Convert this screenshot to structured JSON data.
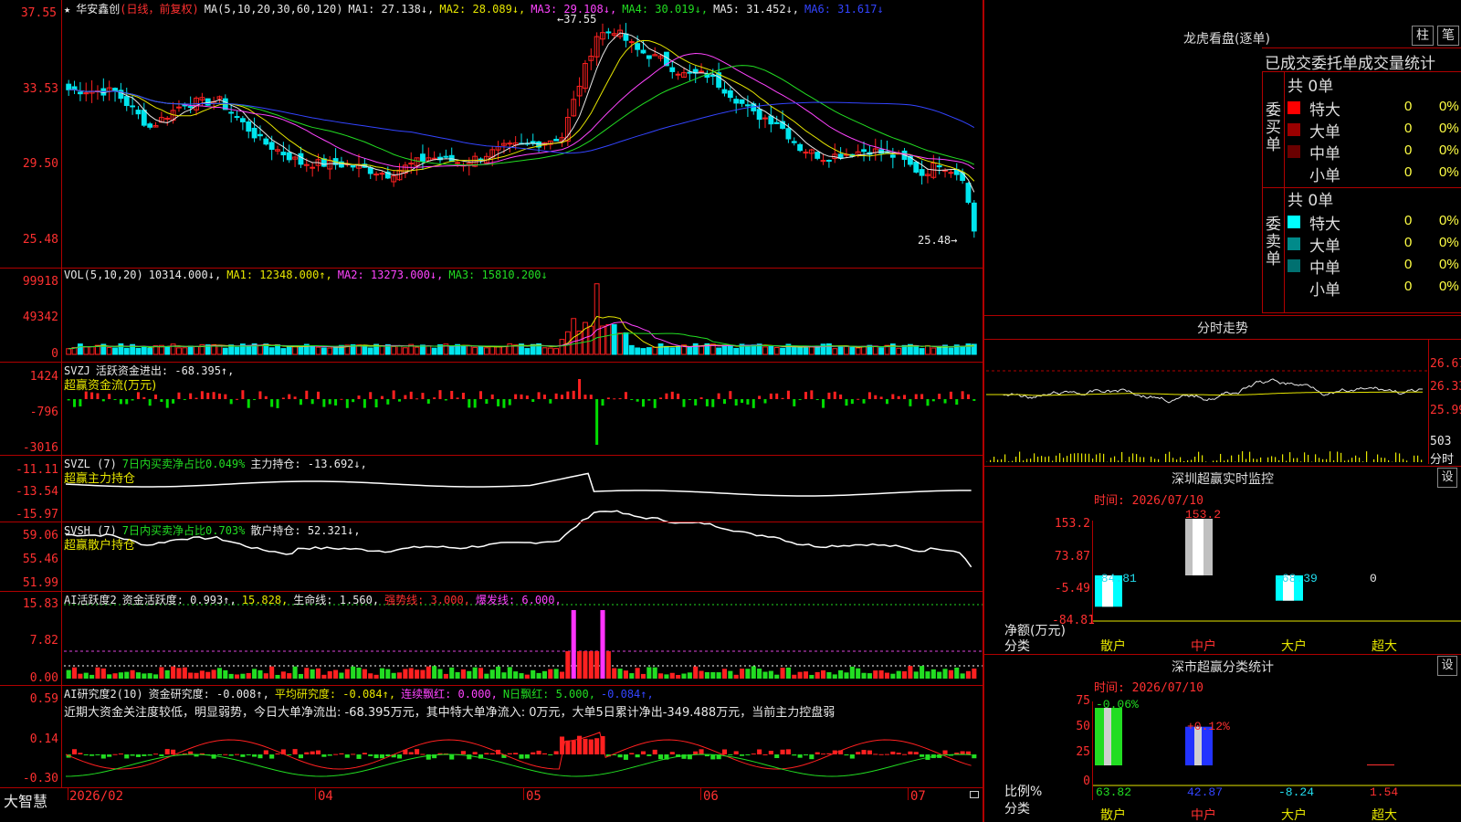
{
  "colors": {
    "up": "#ff2020",
    "down": "#00e5ee",
    "grid": "#b00000",
    "ma1": "#e8e8e8",
    "ma2": "#e6e600",
    "ma3": "#ff44ff",
    "ma4": "#22dd22",
    "ma6": "#3344ff"
  },
  "header": {
    "star": "★",
    "stock_name": "华安鑫创",
    "period": "(日线，前复权)",
    "ma_params": "MA(5,10,20,30,60,120)",
    "ma1": "MA1: 27.138↓,",
    "ma2": "MA2: 28.089↓,",
    "ma3": "MA3: 29.108↓,",
    "ma4": "MA4: 30.019↓,",
    "ma5": "MA5: 31.452↓,",
    "ma6": "MA6: 31.617↓"
  },
  "price_axis": {
    "labels": [
      "37.55",
      "33.53",
      "29.50",
      "25.48"
    ]
  },
  "price_marks": {
    "high": "37.55",
    "low": "25.48"
  },
  "vol": {
    "title": "VOL(5,10,20)",
    "value": "10314.000↓,",
    "ma1": "MA1: 12348.000↑,",
    "ma2": "MA2: 13273.000↓,",
    "ma3": "MA3: 15810.200↓",
    "axis": [
      "99918",
      "49342",
      "0"
    ]
  },
  "svzj": {
    "title": "SVZJ",
    "text": "活跃资金进出: -68.395↑,",
    "sub": "超赢资金流(万元)",
    "axis": [
      "1424",
      "-796",
      "-3016"
    ]
  },
  "svzl": {
    "title": "SVZL (7)",
    "t1": "7日内买卖净占比0.049%",
    "t2": "主力持仓: -13.692↓,",
    "sub": "超赢主力持仓",
    "axis": [
      "-11.11",
      "-13.54",
      "-15.97"
    ]
  },
  "svsh": {
    "title": "SVSH (7)",
    "t1": "7日内买卖净占比0.703%",
    "t2": "散户持仓: 52.321↓,",
    "sub": "超赢散户持仓",
    "axis": [
      "59.06",
      "55.46",
      "51.99"
    ]
  },
  "ai1": {
    "title": "AI活跃度2",
    "t1": "资金活跃度: 0.993↑,",
    "t2": "15.828,",
    "t3": "生命线: 1.560,",
    "t4": "强势线: 3.000,",
    "t5": "爆发线: 6.000,",
    "axis": [
      "15.83",
      "7.82",
      "0.00"
    ]
  },
  "ai2": {
    "title": "AI研究度2(10)",
    "t1": "资金研究度: -0.008↑,",
    "t2": "平均研究度: -0.084↑,",
    "t3": "连续飘红: 0.000,",
    "t4": "N日飘红: 5.000,",
    "t5": "-0.084↑,",
    "comment": "近期大资金关注度较低，明显弱势，今日大单净流出: -68.395万元，其中特大单净流入: 0万元，大单5日累计净出-349.488万元，当前主力控盘弱",
    "axis": [
      "0.59",
      "0.14",
      "-0.30"
    ]
  },
  "date_axis": {
    "brand": "大智慧",
    "labels": [
      "2026/02",
      "04",
      "05",
      "06",
      "07"
    ]
  },
  "longhu": {
    "title": "龙虎看盘(逐单)",
    "btn1": "柱",
    "btn2": "笔",
    "tabs": "已成交委托单成交量统计",
    "buy": {
      "side": "委买单",
      "total": "共 0单",
      "rows": [
        {
          "label": "特大",
          "n": "0",
          "p": "0%",
          "color": "#ff0000"
        },
        {
          "label": "大单",
          "n": "0",
          "p": "0%",
          "color": "#9a0000"
        },
        {
          "label": "中单",
          "n": "0",
          "p": "0%",
          "color": "#6a0000"
        },
        {
          "label": "小单",
          "n": "0",
          "p": "0%",
          "color": ""
        }
      ]
    },
    "sell": {
      "side": "委卖单",
      "total": "共 0单",
      "rows": [
        {
          "label": "特大",
          "n": "0",
          "p": "0%",
          "color": "#00ffff"
        },
        {
          "label": "大单",
          "n": "0",
          "p": "0%",
          "color": "#008a8a"
        },
        {
          "label": "中单",
          "n": "0",
          "p": "0%",
          "color": "#007070"
        },
        {
          "label": "小单",
          "n": "0",
          "p": "0%",
          "color": ""
        }
      ]
    }
  },
  "fenshi": {
    "title": "分时走势",
    "axis": [
      "26.67",
      "26.33",
      "25.99"
    ],
    "vol": "503",
    "vol_label": "分时"
  },
  "sz_monitor": {
    "title": "深圳超赢实时监控",
    "gear": "设",
    "time": "时间: 2026/07/10",
    "axis": [
      "153.2",
      "73.87",
      "-5.49",
      "-84.81"
    ],
    "ylabel": "净额(万元)",
    "xlabel": "分类",
    "cats": [
      "散户",
      "中户",
      "大户",
      "超大"
    ],
    "values": [
      -84.81,
      153.2,
      -68.39,
      0
    ],
    "labels": [
      "-84.81",
      "153.2",
      "-68.39",
      "0"
    ]
  },
  "sz_stats": {
    "title": "深市超赢分类统计",
    "gear": "设",
    "time": "时间: 2026/07/10",
    "axis": [
      "75",
      "50",
      "25",
      "0"
    ],
    "ylabel": "比例%",
    "xlabel": "分类",
    "cats": [
      "散户",
      "中户",
      "大户",
      "超大"
    ],
    "values": [
      63.82,
      42.87,
      -8.24,
      1.54
    ],
    "bottom_labels": [
      "63.82",
      "42.87",
      "-8.24",
      "1.54"
    ],
    "top_labels": [
      "-0.06%",
      "+0.12%"
    ]
  }
}
